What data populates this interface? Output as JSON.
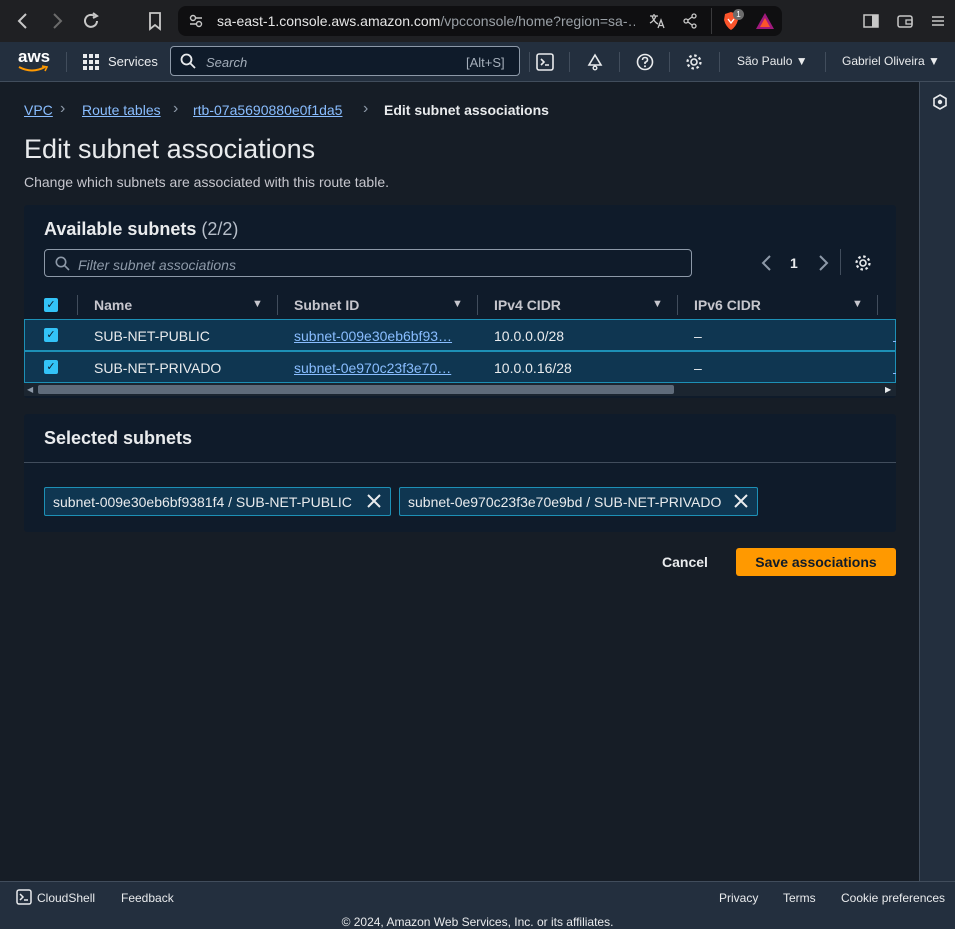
{
  "browser": {
    "url_host": "sa-east-1.console.aws.amazon.com",
    "url_path": "/vpcconsole/home?region=sa-…",
    "brave_badge": "1"
  },
  "aws_nav": {
    "logo": "aws",
    "services_label": "Services",
    "search_placeholder": "Search",
    "search_shortcut": "[Alt+S]",
    "region_label": "São Paulo",
    "user_label": "Gabriel Oliveira"
  },
  "breadcrumb": {
    "items": [
      "VPC",
      "Route tables",
      "rtb-07a5690880e0f1da5"
    ],
    "current": "Edit subnet associations"
  },
  "page": {
    "title": "Edit subnet associations",
    "description": "Change which subnets are associated with this route table."
  },
  "available_subnets": {
    "title": "Available subnets",
    "count": "(2/2)",
    "filter_placeholder": "Filter subnet associations",
    "page_number": "1",
    "columns": [
      "Name",
      "Subnet ID",
      "IPv4 CIDR",
      "IPv6 CIDR"
    ],
    "rows": [
      {
        "name": "SUB-NET-PUBLIC",
        "subnet_id": "subnet-009e30eb6bf93…",
        "ipv4": "10.0.0.0/28",
        "ipv6": "–"
      },
      {
        "name": "SUB-NET-PRIVADO",
        "subnet_id": "subnet-0e970c23f3e70…",
        "ipv4": "10.0.0.16/28",
        "ipv6": "–"
      }
    ]
  },
  "selected_subnets": {
    "title": "Selected subnets",
    "tokens": [
      "subnet-009e30eb6bf9381f4 / SUB-NET-PUBLIC",
      "subnet-0e970c23f3e70e9bd / SUB-NET-PRIVADO"
    ]
  },
  "actions": {
    "cancel": "Cancel",
    "save": "Save associations"
  },
  "footer": {
    "cloudshell": "CloudShell",
    "feedback": "Feedback",
    "privacy": "Privacy",
    "terms": "Terms",
    "cookies": "Cookie preferences",
    "copyright": "© 2024, Amazon Web Services, Inc. or its affiliates."
  },
  "colors": {
    "accent": "#ff9900",
    "link": "#89bdff",
    "selected_row": "#0f3651",
    "checkbox": "#33c3f7"
  }
}
